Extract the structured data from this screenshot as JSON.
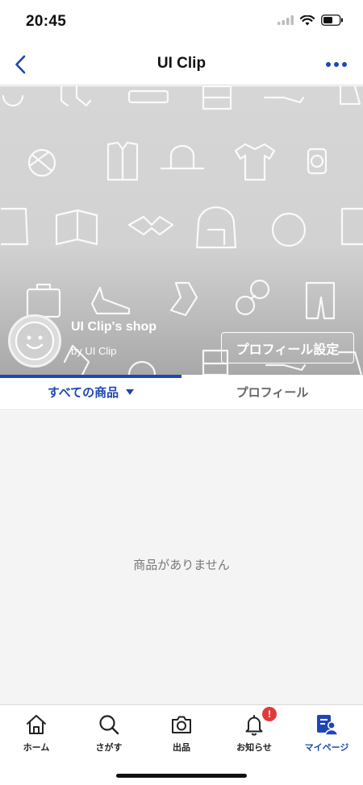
{
  "status_bar": {
    "time": "20:45"
  },
  "nav": {
    "title": "UI Clip"
  },
  "shop": {
    "name": "UI Clip's shop",
    "owner": "by UI Clip",
    "profile_settings_label": "プロフィール設定"
  },
  "tabs": [
    {
      "label": "すべての商品",
      "active": true
    },
    {
      "label": "プロフィール",
      "active": false
    }
  ],
  "content": {
    "empty_message": "商品がありません"
  },
  "tab_bar": {
    "items": [
      {
        "label": "ホーム",
        "icon": "home-icon"
      },
      {
        "label": "さがす",
        "icon": "search-icon"
      },
      {
        "label": "出品",
        "icon": "camera-icon"
      },
      {
        "label": "お知らせ",
        "icon": "bell-icon",
        "badge": "!"
      },
      {
        "label": "マイページ",
        "icon": "mypage-icon",
        "active": true
      }
    ]
  },
  "colors": {
    "accent": "#1f47b3",
    "badge": "#e03a3a",
    "empty_bg": "#f4f4f4"
  }
}
